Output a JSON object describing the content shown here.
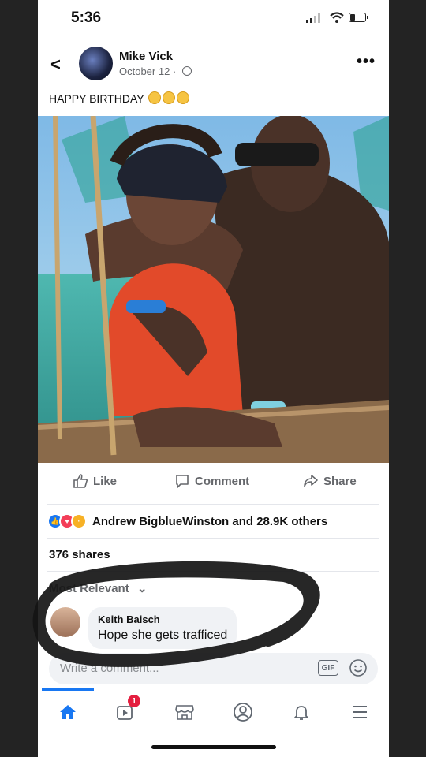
{
  "status": {
    "time": "5:36"
  },
  "post": {
    "author": "Mike Vick",
    "date": "October 12 ·",
    "caption": "HAPPY BIRTHDAY",
    "more": "•••"
  },
  "actions": {
    "like": "Like",
    "comment": "Comment",
    "share": "Share"
  },
  "reactions": {
    "text": "Andrew BigblueWinston and 28.9K others"
  },
  "shares": "376 shares",
  "sort": {
    "label": "Most Relevant",
    "chevron": "⌄"
  },
  "comment": {
    "name": "Keith Baisch",
    "text": "Hope she gets trafficed"
  },
  "compose": {
    "placeholder": "Write a comment...",
    "gif": "GIF"
  },
  "nav": {
    "watch_badge": "1"
  },
  "icons": [
    "back-icon",
    "globe-icon",
    "more-icon",
    "like-icon",
    "comment-icon",
    "share-icon",
    "gif-icon",
    "emoji-icon",
    "home-icon",
    "watch-icon",
    "marketplace-icon",
    "profile-icon",
    "bell-icon",
    "menu-icon"
  ],
  "colors": {
    "accent": "#1877f2",
    "badge": "#e41e3f",
    "text_secondary": "#65676b"
  }
}
